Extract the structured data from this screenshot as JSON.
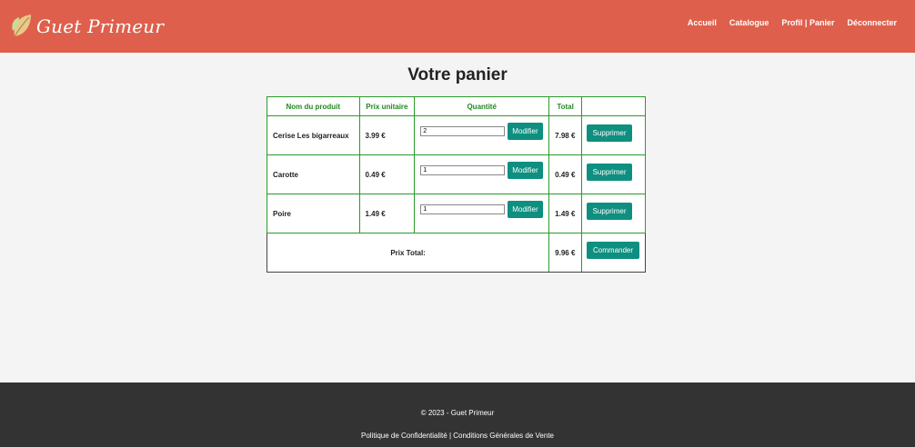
{
  "header": {
    "logo_text": "Guet Primeur",
    "nav": [
      "Accueil",
      "Catalogue",
      "Profil | Panier",
      "Déconnecter"
    ]
  },
  "page_title": "Votre panier",
  "table": {
    "headers": [
      "Nom du produit",
      "Prix unitaire",
      "Quantité",
      "Total",
      ""
    ],
    "rows": [
      {
        "name": "Cerise Les bigarreaux",
        "price": "3.99 €",
        "qty": "2",
        "total": "7.98 €",
        "modify": "Modifier",
        "delete": "Supprimer"
      },
      {
        "name": "Carotte",
        "price": "0.49 €",
        "qty": "1",
        "total": "0.49 €",
        "modify": "Modifier",
        "delete": "Supprimer"
      },
      {
        "name": "Poire",
        "price": "1.49 €",
        "qty": "1",
        "total": "1.49 €",
        "modify": "Modifier",
        "delete": "Supprimer"
      }
    ],
    "total_label": "Prix Total:",
    "total_value": "9.96 €",
    "order_button": "Commander"
  },
  "footer": {
    "copyright": "© 2023 - Guet Primeur",
    "privacy": "Politique de Confidentialité",
    "separator": " | ",
    "terms": "Conditions Générales de Vente"
  },
  "colors": {
    "header_bg": "#de604c",
    "button_bg": "#0e8f80",
    "table_accent": "#2a9a2a",
    "footer_bg": "#333333"
  }
}
